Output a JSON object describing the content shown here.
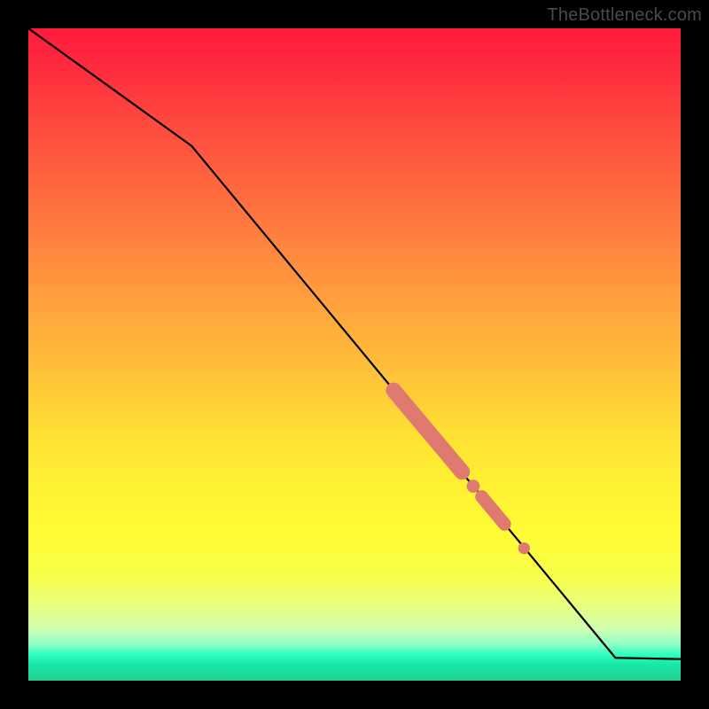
{
  "watermark": "TheBottleneck.com",
  "colors": {
    "background": "#000000",
    "line": "#000000",
    "marker": "#e07a70"
  },
  "chart_data": {
    "type": "line",
    "title": "",
    "xlabel": "",
    "ylabel": "",
    "xlim": [
      0,
      100
    ],
    "ylim": [
      0,
      100
    ],
    "grid": false,
    "legend": false,
    "series": [
      {
        "name": "main-curve",
        "x": [
          0,
          25,
          90,
          100
        ],
        "y": [
          100,
          82,
          3.5,
          3.3
        ]
      }
    ],
    "markers": [
      {
        "name": "segment-a",
        "shape": "pill",
        "x_range": [
          56,
          66.5
        ],
        "y_range": [
          44.5,
          32
        ],
        "thickness": 2.4
      },
      {
        "name": "gap-dot-a",
        "shape": "dot",
        "x": 68.2,
        "y": 29.8,
        "r": 1.0
      },
      {
        "name": "segment-b",
        "shape": "pill",
        "x_range": [
          69.5,
          73
        ],
        "y_range": [
          28.2,
          24
        ],
        "thickness": 2.0
      },
      {
        "name": "gap-dot-b",
        "shape": "dot",
        "x": 76,
        "y": 20.3,
        "r": 0.9
      }
    ]
  }
}
